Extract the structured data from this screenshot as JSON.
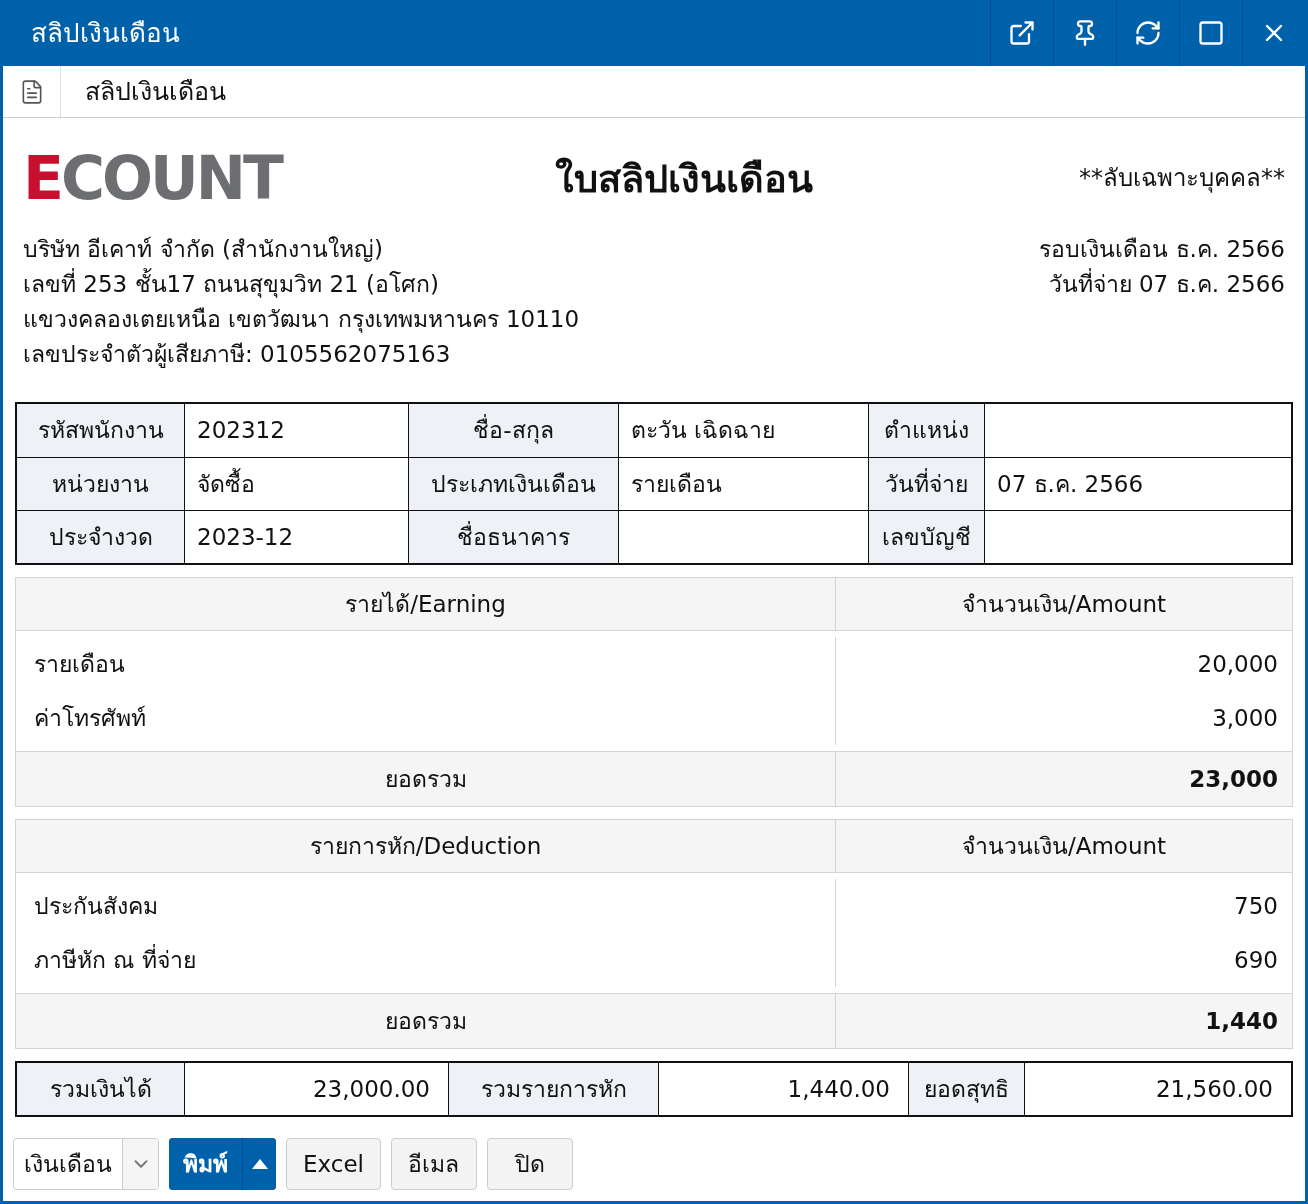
{
  "window": {
    "title": "สลิปเงินเดือน"
  },
  "tab": {
    "title": "สลิปเงินเดือน"
  },
  "header": {
    "logo": "ECOUNT",
    "title": "ใบสลิปเงินเดือน",
    "confidential": "**ลับเฉพาะบุคคล**"
  },
  "company_lines": [
    "บริษัท อีเคาท์ จำกัด (สำนักงานใหญ่)",
    "เลขที่ 253 ชั้น17 ถนนสุขุมวิท 21 (อโศก)",
    "แขวงคลองเตยเหนือ เขตวัฒนา กรุงเทพมหานคร 10110",
    "เลขประจำตัวผู้เสียภาษี: 0105562075163"
  ],
  "pay_lines": [
    "รอบเงินเดือน ธ.ค. 2566",
    "วันที่จ่าย 07 ธ.ค. 2566"
  ],
  "employee_info": [
    [
      {
        "label": "รหัสพนักงาน",
        "value": "202312"
      },
      {
        "label": "ชื่อ-สกุล",
        "value": "ตะวัน เฉิดฉาย"
      },
      {
        "label": "ตำแหน่ง"
      }
    ],
    [
      {
        "label": "หน่วยงาน",
        "value": "จัดซื้อ"
      },
      {
        "label": "ประเภทเงินเดือน",
        "value": "รายเดือน"
      },
      {
        "label": "วันที่จ่าย",
        "value": "07 ธ.ค. 2566"
      }
    ],
    [
      {
        "label": "ประจำงวด",
        "value": "2023-12"
      },
      {
        "label": "ชื่อธนาคาร"
      },
      {
        "label": "เลขบัญชี"
      }
    ]
  ],
  "earnings": {
    "columns": [
      "รายได้/Earning",
      "จำนวนเงิน/Amount"
    ],
    "items": [
      {
        "name": "รายเดือน",
        "amount": "20,000"
      },
      {
        "name": "ค่าโทรศัพท์",
        "amount": "3,000"
      }
    ],
    "total": {
      "label": "ยอดรวม",
      "amount": "23,000"
    }
  },
  "deductions": {
    "columns": [
      "รายการหัก/Deduction",
      "จำนวนเงิน/Amount"
    ],
    "items": [
      {
        "name": "ประกันสังคม",
        "amount": "750"
      },
      {
        "name": "ภาษีหัก ณ ที่จ่าย",
        "amount": "690"
      }
    ],
    "total": {
      "label": "ยอดรวม",
      "amount": "1,440"
    }
  },
  "summary": [
    {
      "label": "รวมเงินได้",
      "value": "23,000.00"
    },
    {
      "label": "รวมรายการหัก",
      "value": "1,440.00"
    },
    {
      "label": "ยอดสุทธิ",
      "value": "21,560.00"
    }
  ],
  "footer": {
    "select": {
      "value": "เงินเดือน"
    },
    "buttons": [
      {
        "label": "พิมพ์",
        "kind": "split"
      },
      {
        "label": "Excel",
        "kind": "plain"
      },
      {
        "label": "อีเมล",
        "kind": "plain"
      },
      {
        "label": "ปิด",
        "kind": "plain"
      }
    ]
  }
}
